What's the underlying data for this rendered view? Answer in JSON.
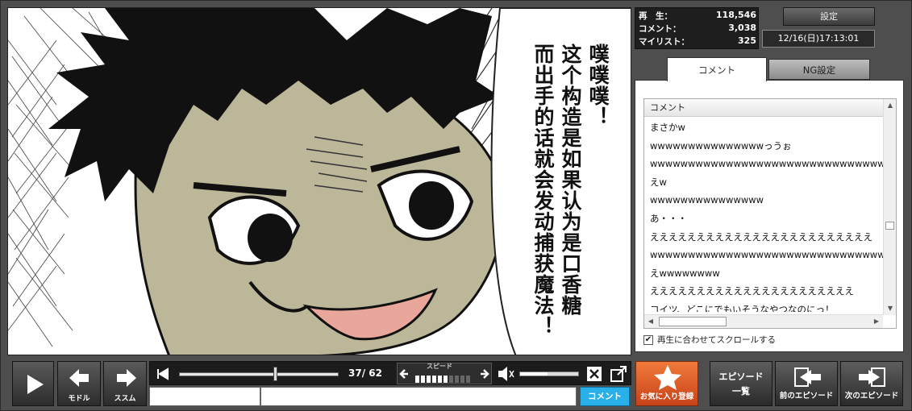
{
  "stats": {
    "views_label": "再　生：",
    "views": "118,546",
    "comments_label": "コメント：",
    "comments": "3,038",
    "mylist_label": "マイリスト：",
    "mylist": "325"
  },
  "settings_label": "設定",
  "datetime": "12/16(日)17:13:01",
  "tabs": {
    "comment": "コメント",
    "ng": "NG設定"
  },
  "comment_list": {
    "header": "コメント",
    "rows": [
      "まさかw",
      "wwwwwwwwwwwwwwwっうぉ",
      "wwwwwwwwwwwwwwwwwwwwwwwwwwwwwwww",
      "えw",
      "wwwwwwwwwwwwwww",
      "あ・・・",
      "ええええええええええええええええええええええええ",
      "wwwwwwwwwwwwwwwwwwwwwwwwwwwwwww",
      "えwwwwwwww",
      "ええええええええええええええええええええええ",
      "コイツ、どこにでもいそうなやつなのにっ！"
    ]
  },
  "autoscroll_label": "再生に合わせてスクロールする",
  "subtitle_columns": [
    "噗噗噗！",
    "这个构造是如果认为是口香糖",
    "而出手的话就会发动捕获魔法！"
  ],
  "controls": {
    "back_label": "モドル",
    "forward_label": "ススム",
    "time": "37/ 62",
    "speed_label": "スピード",
    "comment_button": "コメント",
    "favorite_label": "お気に入り登録",
    "episode_list_label": "エピソード\n一覧",
    "prev_episode_label": "前のエピソード",
    "next_episode_label": "次のエピソード",
    "seek_fraction": 0.59,
    "volume_fraction": 0.47
  },
  "colors": {
    "accent_comment": "#2ab0e8",
    "favorite": "#e0602a",
    "bar_bg": "#1c1c1c"
  }
}
